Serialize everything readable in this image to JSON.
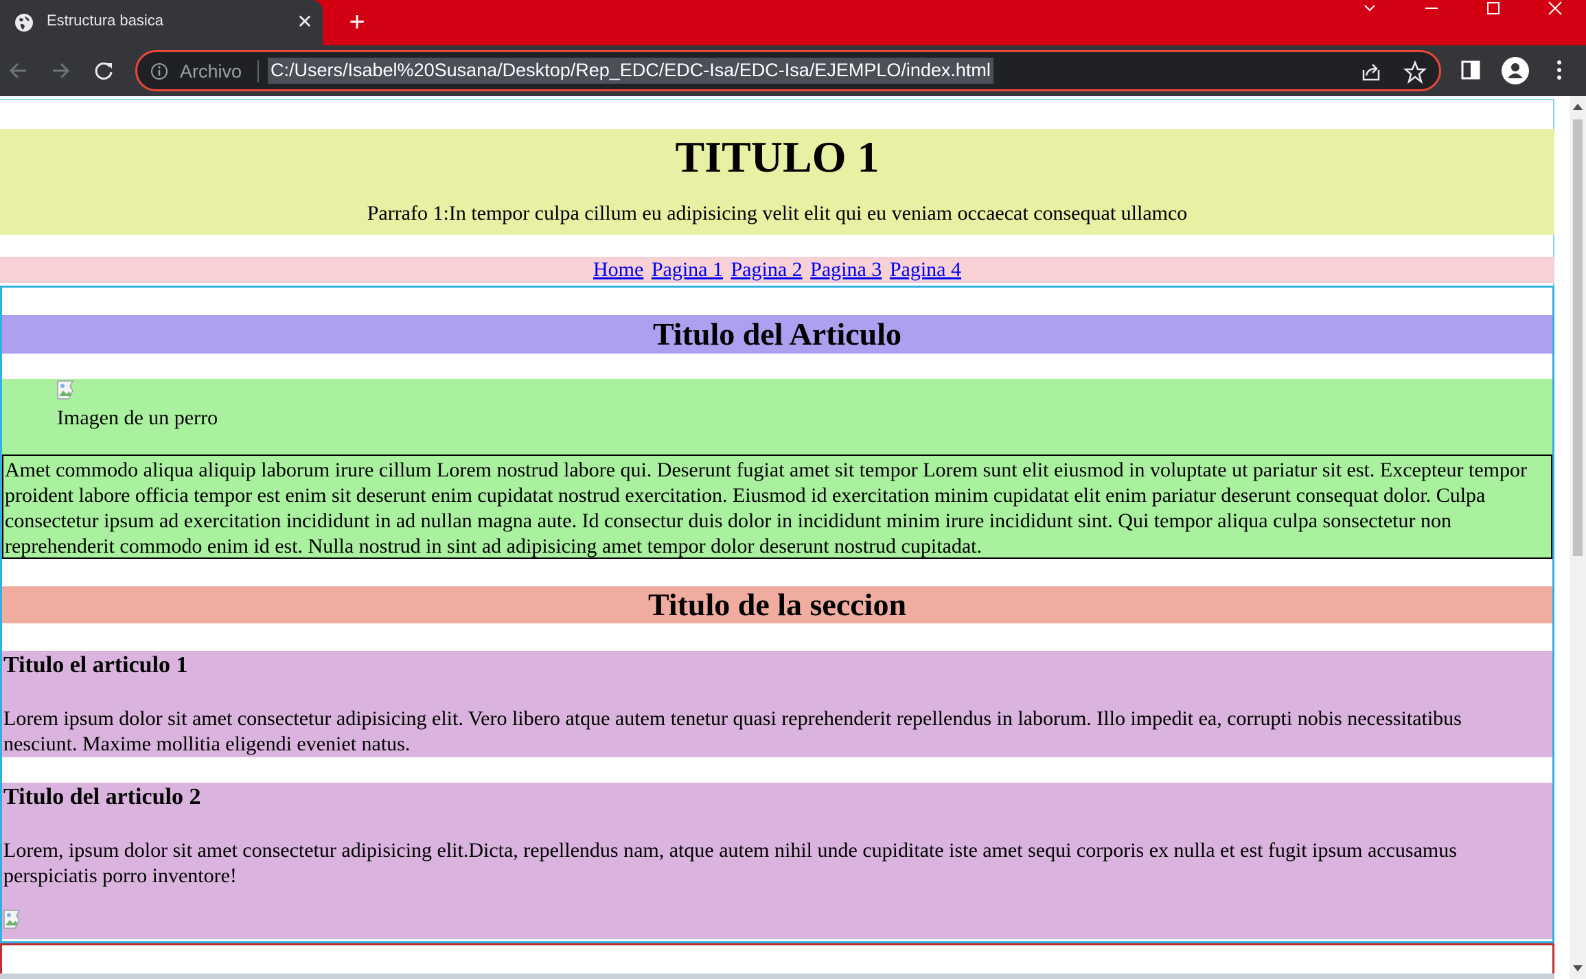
{
  "browser": {
    "tab_title": "Estructura basica",
    "new_tab_symbol": "+",
    "close_tab_symbol": "✕",
    "address_label": "Archivo",
    "url": "C:/Users/Isabel%20Susana/Desktop/Rep_EDC/EDC-Isa/EDC-Isa/EJEMPLO/index.html",
    "colors": {
      "tabstrip": "#d30013",
      "toolbar": "#35363a",
      "omnibox_border": "#e8473b"
    }
  },
  "page": {
    "h1": "TITULO 1",
    "intro_paragraph": "Parrafo 1:In tempor culpa cillum eu adipisicing velit elit qui eu veniam occaecat consequat ullamco",
    "nav": [
      "Home",
      "Pagina 1",
      "Pagina 2",
      "Pagina 3",
      "Pagina 4"
    ],
    "article": {
      "title": "Titulo del Articulo",
      "figure_caption": "Imagen de un perro",
      "paragraph": "Amet commodo aliqua aliquip laborum irure cillum Lorem nostrud labore qui. Deserunt fugiat amet sit tempor Lorem sunt elit eiusmod in voluptate ut pariatur sit est. Excepteur tempor proident labore officia tempor est enim sit deserunt enim cupidatat nostrud exercitation. Eiusmod id exercitation minim cupidatat elit enim pariatur deserunt consequat dolor. Culpa consectetur ipsum ad exercitation incididunt in ad nullan magna aute. Id consectur duis dolor in incididunt minim irure incididunt sint. Qui tempor aliqua culpa sonsectetur non reprehenderit commodo enim id est. Nulla nostrud in sint ad adipisicing amet tempor dolor deserunt nostrud cupitadat."
    },
    "section": {
      "title": "Titulo de la seccion",
      "articles": [
        {
          "title": "Titulo el articulo 1",
          "text": "Lorem ipsum dolor sit amet consectetur adipisicing elit. Vero libero atque autem tenetur quasi reprehenderit repellendus in laborum. Illo impedit ea, corrupti nobis necessitatibus nesciunt. Maxime mollitia eligendi eveniet natus."
        },
        {
          "title": "Titulo del articulo 2",
          "text": "Lorem, ipsum dolor sit amet consectetur adipisicing elit.Dicta, repellendus nam, atque autem nihil unde cupiditate iste amet sequi corporis ex nulla et est fugit ipsum accusamus perspiciatis porro inventore!"
        }
      ]
    },
    "colors": {
      "header_bg": "#e8f0a3",
      "nav_bg": "#f7d1d6",
      "article_title_bg": "#ae9ff0",
      "figure_bg": "#aaf19f",
      "section_title_bg": "#f0ad9f",
      "sub_article_bg": "#dab4de",
      "link": "#0000ee"
    }
  }
}
